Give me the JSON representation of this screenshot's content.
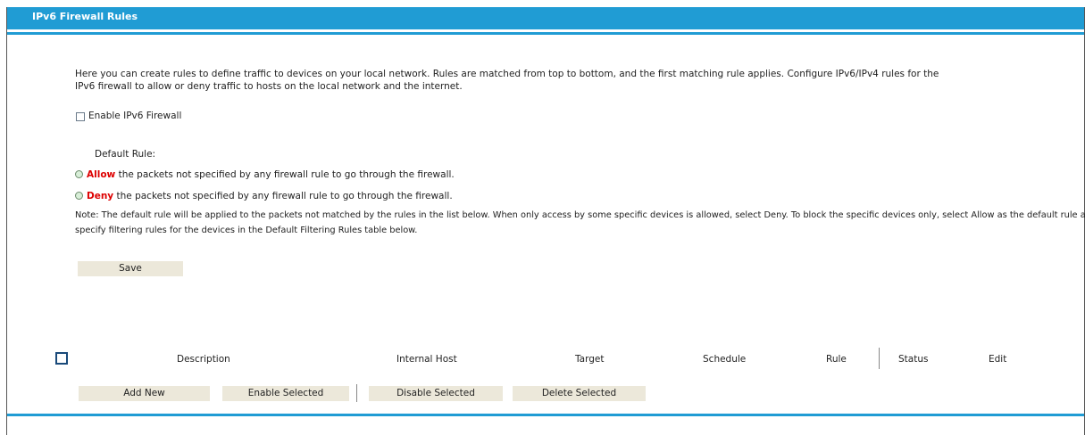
{
  "page": {
    "title": "IPv6 Firewall Rules"
  },
  "intro": {
    "line1": "Here you can create rules to define traffic to devices on your local network. Rules are matched from top to bottom, and the first matching rule applies. Configure IPv6/IPv4 rules for the",
    "line2": "IPv6 firewall to allow or deny traffic to hosts on the local network and the internet."
  },
  "enable": {
    "label": "Enable IPv6 Firewall"
  },
  "default_rule": {
    "heading": "Default Rule:",
    "allow_keyword": "Allow",
    "allow_text": "the packets not specified by any firewall rule to go through the firewall.",
    "deny_keyword": "Deny",
    "deny_text": "the packets not specified by any firewall rule to go through the firewall."
  },
  "note": {
    "line1": "Note: The default rule will be applied to the packets not matched by the rules in the list below. When only access by some specific devices is allowed, select Deny. To block the specific devices only, select Allow as the default rule and",
    "line2": "specify filtering rules for the devices in the Default Filtering Rules table below."
  },
  "save_label": "Save",
  "table": {
    "headers": [
      "Description",
      "Internal Host",
      "Target",
      "Schedule",
      "Rule",
      "Status",
      "Edit"
    ]
  },
  "actions": {
    "add_new": "Add New",
    "enable_selected": "Enable Selected",
    "disable_selected": "Disable Selected",
    "delete_selected": "Delete Selected"
  },
  "colors": {
    "accent": "#209cd4",
    "deny_allow_keyword": "#dd0000",
    "button_bg": "#ece8da"
  }
}
